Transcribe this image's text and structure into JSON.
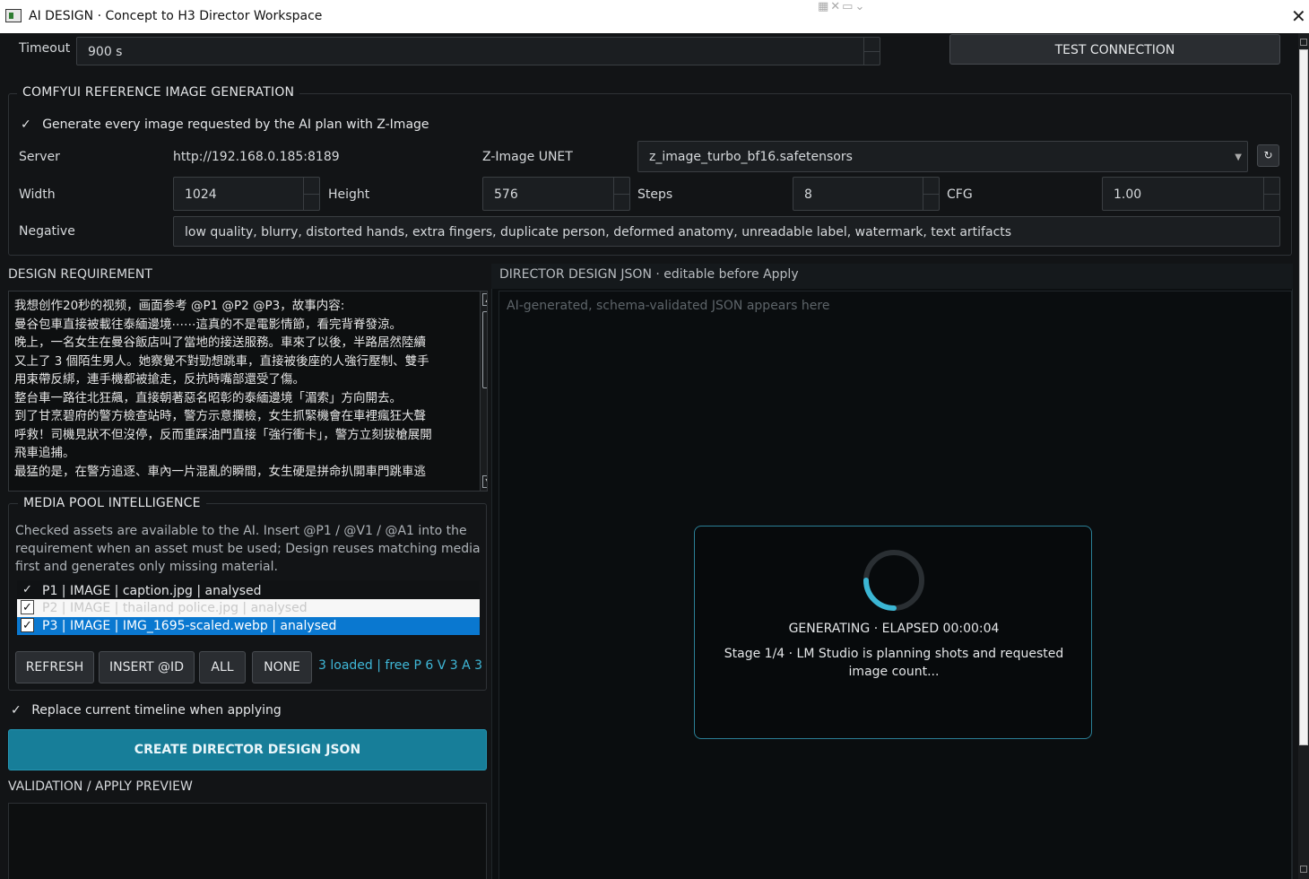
{
  "window": {
    "title": "AI DESIGN · Concept to H3 Director Workspace",
    "toolbar_glyphs": "▦✕▭⌄",
    "close_glyph": "✕"
  },
  "connection": {
    "timeout_label": "Timeout",
    "timeout_value": "900 s",
    "test_button": "TEST CONNECTION"
  },
  "comfyui": {
    "group_title": "COMFYUI REFERENCE IMAGE GENERATION",
    "generate_check": "✓",
    "generate_label": "Generate every image requested by the AI plan with Z-Image",
    "server_label": "Server",
    "server_value": "http://192.168.0.185:8189",
    "unet_label": "Z-Image UNET",
    "unet_value": "z_image_turbo_bf16.safetensors",
    "refresh_glyph": "↻",
    "width_label": "Width",
    "width_value": "1024",
    "height_label": "Height",
    "height_value": "576",
    "steps_label": "Steps",
    "steps_value": "8",
    "cfg_label": "CFG",
    "cfg_value": "1.00",
    "negative_label": "Negative",
    "negative_value": "low quality, blurry, distorted hands, extra fingers, duplicate person, deformed anatomy, unreadable label, watermark, text artifacts"
  },
  "design": {
    "label": "DESIGN REQUIREMENT",
    "lines": [
      "我想创作20秒的视频，画面参考 @P1 @P2 @P3，故事内容:",
      "曼谷包車直接被載往泰緬邊境⋯⋯這真的不是電影情節，看完背脊發涼。",
      "晚上，一名女生在曼谷飯店叫了當地的接送服務。車來了以後，半路居然陸續",
      "又上了 3 個陌生男人。她察覺不對勁想跳車，直接被後座的人強行壓制、雙手",
      "用束帶反綁，連手機都被搶走，反抗時嘴部還受了傷。",
      "整台車一路往北狂飆，直接朝著惡名昭彰的泰緬邊境「湄索」方向開去。",
      "到了甘烹碧府的警方檢查站時，警方示意攔檢，女生抓緊機會在車裡瘋狂大聲",
      "呼救！司機見狀不但沒停，反而重踩油門直接「強行衝卡」，警方立刻拔槍展開",
      "飛車追捕。",
      "最猛的是，在警方追逐、車內一片混亂的瞬間，女生硬是拼命扒開車門跳車逃"
    ],
    "scroll_up": "▲",
    "scroll_down": "▼"
  },
  "media_pool": {
    "group_title": "MEDIA POOL INTELLIGENCE",
    "description": "Checked assets are available to the AI. Insert @P1 / @V1 / @A1 into the requirement when an asset must be used; Design reuses matching media first and generates only missing material.",
    "check_glyph": "✓",
    "assets": [
      {
        "label": "P1  |  IMAGE  |  caption.jpg  |  analysed"
      },
      {
        "label": "P2  |  IMAGE  |  thailand police.jpg  |  analysed"
      },
      {
        "label": "P3  |  IMAGE  |  IMG_1695-scaled.webp  |  analysed"
      }
    ],
    "buttons": {
      "refresh": "REFRESH",
      "insert": "INSERT @ID",
      "all": "ALL",
      "none": "NONE"
    },
    "status": "3 loaded  |  free P 6 V 3 A 3"
  },
  "replace_check": "✓",
  "replace_label": "Replace current timeline when applying",
  "create_button": "CREATE DIRECTOR DESIGN JSON",
  "validation_label": "VALIDATION / APPLY PREVIEW",
  "json_panel": {
    "header": "DIRECTOR DESIGN JSON · editable before Apply",
    "placeholder": "AI-generated, schema-validated JSON appears here"
  },
  "generating": {
    "status": "GENERATING  ·  ELAPSED 00:00:04",
    "stage": "Stage 1/4 · LM Studio is planning shots and requested image count..."
  },
  "colors": {
    "accent": "#177e99",
    "spinner": "#3bb6d4",
    "selection": "#0a78d0",
    "status_text": "#3fb8d8"
  }
}
